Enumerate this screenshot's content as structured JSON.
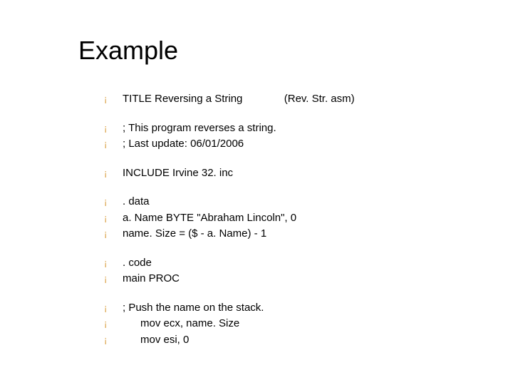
{
  "title": "Example",
  "bullet_char": "¡",
  "groups": [
    [
      "TITLE Reversing a String              (Rev. Str. asm)"
    ],
    [
      "; This program reverses a string.",
      "; Last update: 06/01/2006"
    ],
    [
      "INCLUDE Irvine 32. inc"
    ],
    [
      ". data",
      "a. Name BYTE \"Abraham Lincoln\", 0",
      "name. Size = ($ - a. Name) - 1"
    ],
    [
      ". code",
      "main PROC"
    ],
    [
      "; Push the name on the stack.",
      "      mov ecx, name. Size",
      "      mov esi, 0"
    ]
  ]
}
